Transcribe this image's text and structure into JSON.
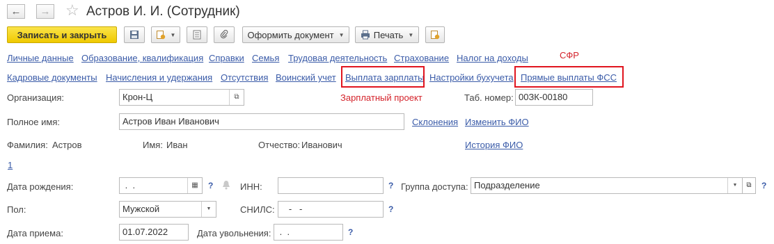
{
  "window": {
    "title": "Астров И. И. (Сотрудник)",
    "back_icon": "←",
    "forward_icon": "→",
    "favorite_icon": "☆"
  },
  "toolbar": {
    "save_close_label": "Записать и закрыть",
    "save_icon": "save-icon",
    "create_based_icon": "create-based-on-icon",
    "list_icon": "list-icon",
    "attach_icon": "paperclip-icon",
    "issue_doc_label": "Оформить документ",
    "print_label": "Печать",
    "report_icon": "report-icon"
  },
  "nav_row1": {
    "personal": "Личные данные",
    "education": "Образование, квалификация",
    "certificates": "Справки",
    "family": "Семья",
    "work": "Трудовая деятельность",
    "insurance": "Страхование",
    "income_tax": "Налог на доходы"
  },
  "annotation_sfr": "СФР",
  "nav_row2": {
    "hr_docs": "Кадровые документы",
    "accruals": "Начисления и удержания",
    "absences": "Отсутствия",
    "military": "Воинский учет",
    "salary_payment": "Выплата зарплаты",
    "accounting_settings": "Настройки бухучета",
    "fss_payments": "Прямые выплаты ФСС"
  },
  "form": {
    "org_label": "Организация:",
    "org_value": "Крон-Ц",
    "salary_project": "Зарплатный проект",
    "tab_label": "Таб. номер:",
    "tab_value": "00ЗК-00180",
    "fullname_label": "Полное имя:",
    "fullname_value": "Астров Иван Иванович",
    "declensions_link": "Склонения",
    "change_fio_link": "Изменить ФИО",
    "surname_label": "Фамилия:",
    "surname_value": "Астров",
    "name_label": "Имя:",
    "name_value": "Иван",
    "patronymic_label": "Отчество:",
    "patronymic_value": "Иванович",
    "history_fio_link": "История ФИО",
    "count_link": "1",
    "birthdate_label": "Дата рождения:",
    "birthdate_value": " .  .",
    "inn_label": "ИНН:",
    "inn_value": "",
    "access_group_label": "Группа доступа:",
    "access_group_value": "Подразделение",
    "gender_label": "Пол:",
    "gender_value": "Мужской",
    "snils_label": "СНИЛС:",
    "snils_value": "   -   -",
    "hire_date_label": "Дата приема:",
    "hire_date_value": "01.07.2022",
    "dismissal_label": "Дата увольнения:",
    "dismissal_value": " .  .",
    "help_mark": "?"
  },
  "colors": {
    "link": "#3a5ba8",
    "highlight": "#e0141e",
    "primary_button": "#f2d01a"
  }
}
